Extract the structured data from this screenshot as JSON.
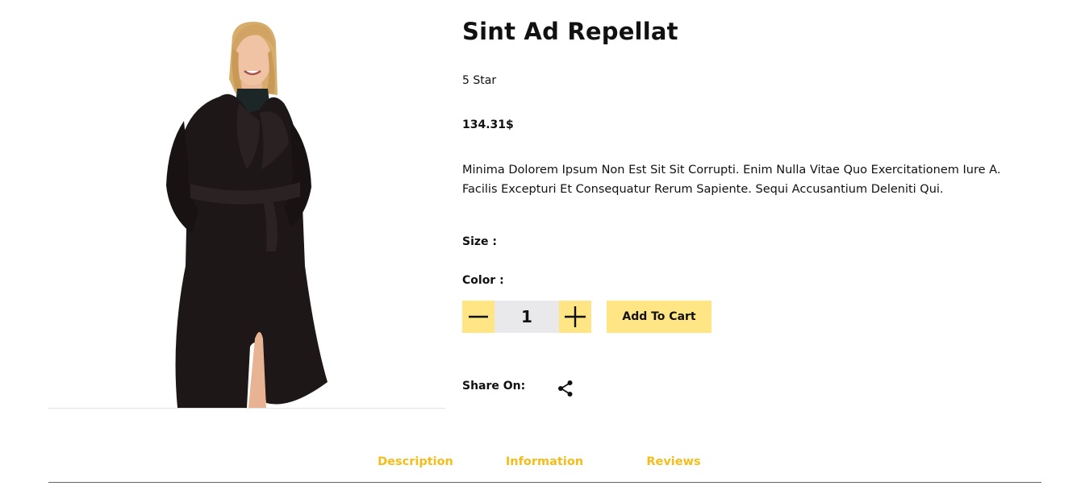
{
  "product": {
    "title": "Sint Ad Repellat",
    "rating": "5 Star",
    "price": "134.31$",
    "description": "Minima Dolorem Ipsum Non Est Sit Sit Corrupti. Enim Nulla Vitae Quo Exercitationem Iure A. Facilis Excepturi Et Consequatur Rerum Sapiente. Sequi Accusantium Deleniti Qui.",
    "size_label": "Size :",
    "color_label": "Color :",
    "quantity": "1",
    "add_to_cart_label": "Add To Cart",
    "share_label": "Share On:",
    "icons": {
      "decrement": "minus-icon",
      "increment": "plus-icon",
      "share": "share-icon"
    }
  },
  "tabs": [
    {
      "label": "Description"
    },
    {
      "label": "Information"
    },
    {
      "label": "Reviews"
    }
  ],
  "colors": {
    "accent": "#ffe584",
    "tab_text": "#f4bd1b",
    "quantity_bg": "#e9e9ec",
    "coat": "#1d1717"
  }
}
